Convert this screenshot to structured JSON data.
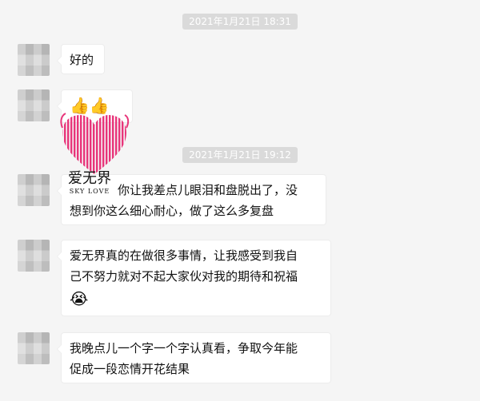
{
  "messages": [
    {
      "type": "timestamp",
      "text": "2021年1月21日 18:31"
    },
    {
      "type": "text",
      "text": "好的"
    },
    {
      "type": "emoji",
      "text": "👍👍"
    },
    {
      "type": "timestamp",
      "text": "2021年1月21日 19:12"
    },
    {
      "type": "text",
      "lines": [
        "你让我差点儿眼泪和盘脱出了，没",
        "想到你这么细心耐心，做了这么多复盘"
      ]
    },
    {
      "type": "text",
      "lines": [
        "爱无界真的在做很多事情，让我感受到我自",
        "己不努力就对不起大家伙对我的期待和祝福"
      ],
      "emoji": "😭"
    },
    {
      "type": "text",
      "lines": [
        "我晚点儿一个字一个字认真看，争取今年能",
        "促成一段恋情开花结果"
      ]
    }
  ],
  "watermark": {
    "logo_text": "爱无界",
    "logo_subtext": "SKY LOVE",
    "heart_color": "#e8357a"
  },
  "colors": {
    "background": "#f5f5f5",
    "bubble": "#ffffff",
    "timestamp_bg": "#dadada"
  }
}
